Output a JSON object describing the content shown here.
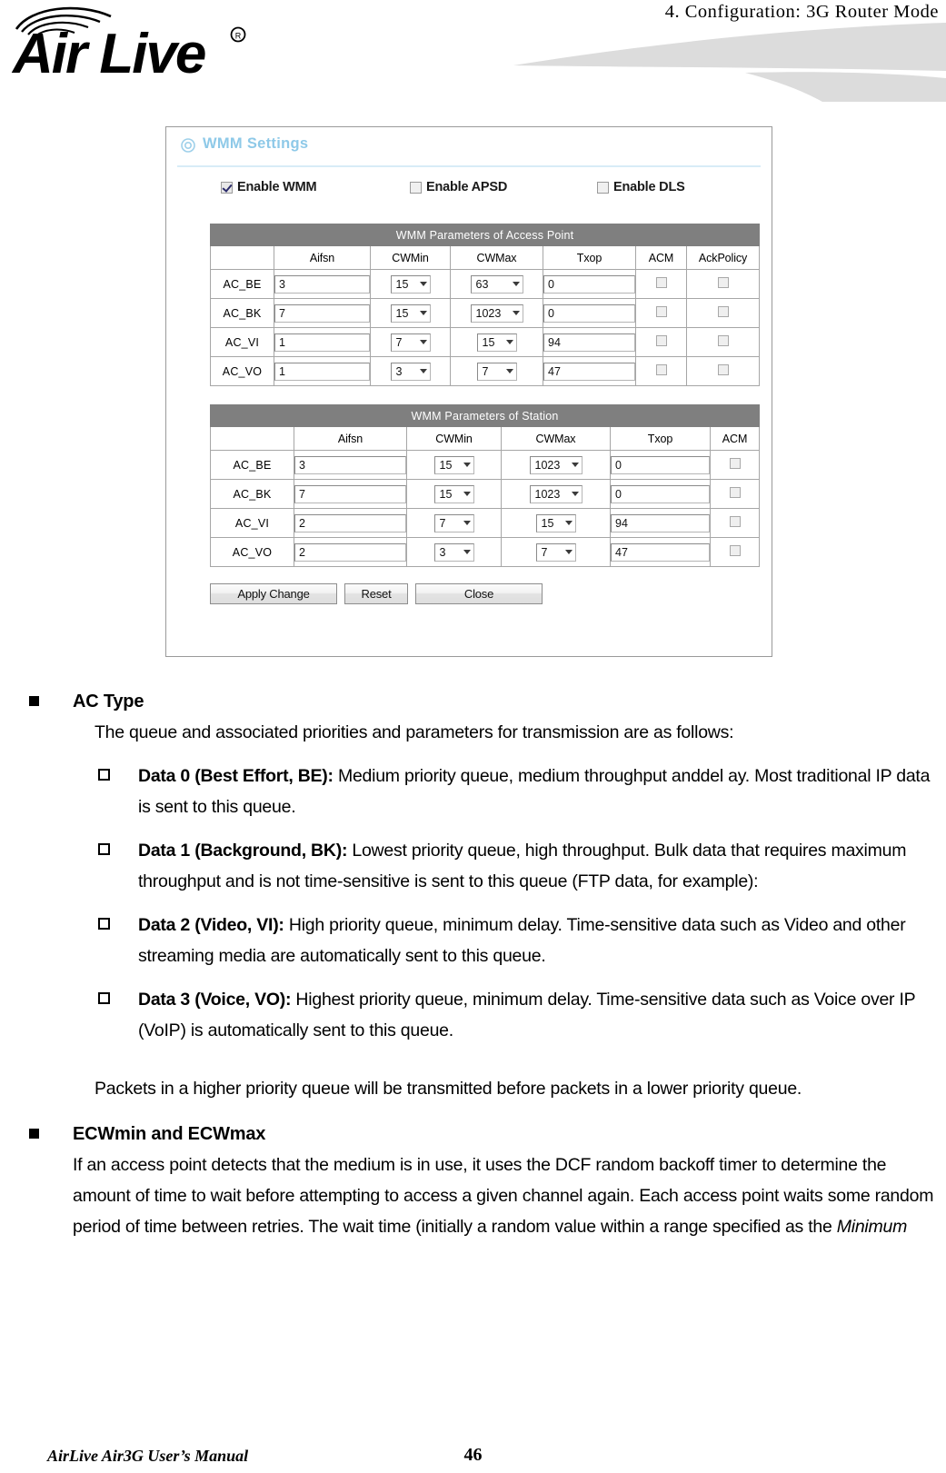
{
  "header": {
    "section_title": "4. Configuration: 3G Router Mode",
    "logo_text": "Air Live",
    "logo_mark": "registered-trademark"
  },
  "screenshot": {
    "panel": {
      "title": "WMM Settings",
      "title_icon": "target-icon"
    },
    "enable_options": [
      {
        "label": "Enable WMM",
        "checked": true,
        "name": "enable-wmm"
      },
      {
        "label": "Enable APSD",
        "checked": false,
        "name": "enable-apsd"
      },
      {
        "label": "Enable DLS",
        "checked": false,
        "name": "enable-dls"
      }
    ],
    "ap_table": {
      "caption": "WMM Parameters of Access Point",
      "columns": [
        "",
        "Aifsn",
        "CWMin",
        "CWMax",
        "Txop",
        "ACM",
        "AckPolicy"
      ],
      "rows": [
        {
          "ac": "AC_BE",
          "aifsn": "3",
          "cwmin": "15",
          "cwmax": "63",
          "txop": "0",
          "acm": false,
          "ackpolicy": false
        },
        {
          "ac": "AC_BK",
          "aifsn": "7",
          "cwmin": "15",
          "cwmax": "1023",
          "txop": "0",
          "acm": false,
          "ackpolicy": false
        },
        {
          "ac": "AC_VI",
          "aifsn": "1",
          "cwmin": "7",
          "cwmax": "15",
          "txop": "94",
          "acm": false,
          "ackpolicy": false
        },
        {
          "ac": "AC_VO",
          "aifsn": "1",
          "cwmin": "3",
          "cwmax": "7",
          "txop": "47",
          "acm": false,
          "ackpolicy": false
        }
      ]
    },
    "sta_table": {
      "caption": "WMM Parameters of Station",
      "columns": [
        "",
        "Aifsn",
        "CWMin",
        "CWMax",
        "Txop",
        "ACM"
      ],
      "rows": [
        {
          "ac": "AC_BE",
          "aifsn": "3",
          "cwmin": "15",
          "cwmax": "1023",
          "txop": "0",
          "acm": false
        },
        {
          "ac": "AC_BK",
          "aifsn": "7",
          "cwmin": "15",
          "cwmax": "1023",
          "txop": "0",
          "acm": false
        },
        {
          "ac": "AC_VI",
          "aifsn": "2",
          "cwmin": "7",
          "cwmax": "15",
          "txop": "94",
          "acm": false
        },
        {
          "ac": "AC_VO",
          "aifsn": "2",
          "cwmin": "3",
          "cwmax": "7",
          "txop": "47",
          "acm": false
        }
      ]
    },
    "buttons": {
      "apply": "Apply Change",
      "reset": "Reset",
      "close": "Close"
    }
  },
  "content": {
    "ac_type": {
      "heading": "AC Type",
      "intro": "The queue and associated priorities and parameters for transmission are as follows:",
      "items": [
        {
          "term": "Data 0 (Best Effort, BE):",
          "desc": " Medium priority queue, medium throughput anddel ay. Most traditional IP data is sent to this queue."
        },
        {
          "term": "Data 1 (Background, BK):",
          "desc": " Lowest priority queue, high throughput. Bulk data that requires maximum throughput and is not time-sensitive is sent to this queue (FTP data, for example):"
        },
        {
          "term": "Data 2 (Video, VI):",
          "desc": " High priority queue, minimum delay. Time-sensitive data such as Video and other streaming media are automatically sent to this queue."
        },
        {
          "term": "Data 3 (Voice, VO):",
          "desc": " Highest priority queue, minimum delay. Time-sensitive data such as Voice over IP (VoIP) is automatically sent to this queue."
        }
      ],
      "closing": "Packets in a higher priority queue will be transmitted before packets in a lower priority queue."
    },
    "ecw": {
      "heading": "ECWmin and ECWmax",
      "body_plain": "If an access point detects that the medium is in use, it uses the DCF random backoff timer to determine the amount of time to wait before attempting to access a given channel again. Each access point waits some random period of time between retries. The wait time (initially a random value within a range specified as the ",
      "body_italic": "Minimum"
    }
  },
  "footer": {
    "manual_title": "AirLive Air3G User’s Manual",
    "page_number": "46"
  }
}
